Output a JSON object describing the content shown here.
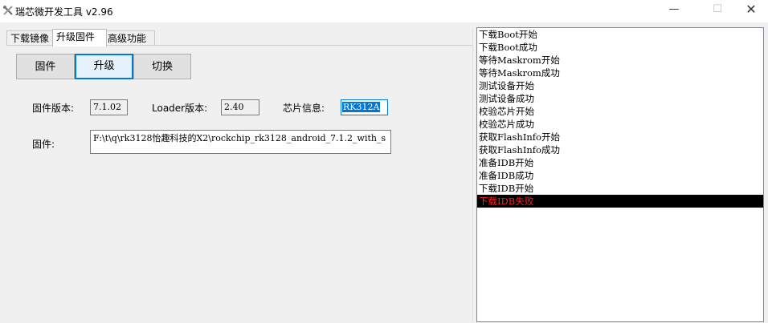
{
  "window": {
    "title": "瑞芯微开发工具 v2.96",
    "min_glyph": "—",
    "max_glyph": "☐",
    "close_glyph": "✕"
  },
  "tabs": [
    {
      "label": "下载镜像",
      "active": false
    },
    {
      "label": "升级固件",
      "active": true
    },
    {
      "label": "高级功能",
      "active": false
    }
  ],
  "buttons": {
    "firmware": "固件",
    "upgrade": "升级",
    "switch": "切换"
  },
  "info": {
    "firmware_version_label": "固件版本:",
    "firmware_version": "7.1.02",
    "loader_version_label": "Loader版本:",
    "loader_version": "2.40",
    "chip_info_label": "芯片信息:",
    "chip_info": "RK312A",
    "firmware_label": "固件:",
    "firmware_path": "F:\\t\\q\\rk3128怡趣科技的X2\\rockchip_rk3128_android_7.1.2_with_s"
  },
  "log": [
    {
      "text": "下载Boot开始",
      "error": false
    },
    {
      "text": "下载Boot成功",
      "error": false
    },
    {
      "text": "等待Maskrom开始",
      "error": false
    },
    {
      "text": "等待Maskrom成功",
      "error": false
    },
    {
      "text": "测试设备开始",
      "error": false
    },
    {
      "text": "测试设备成功",
      "error": false
    },
    {
      "text": "校验芯片开始",
      "error": false
    },
    {
      "text": "校验芯片成功",
      "error": false
    },
    {
      "text": "获取FlashInfo开始",
      "error": false
    },
    {
      "text": "获取FlashInfo成功",
      "error": false
    },
    {
      "text": "准备IDB开始",
      "error": false
    },
    {
      "text": "准备IDB成功",
      "error": false
    },
    {
      "text": "下载IDB开始",
      "error": false
    },
    {
      "text": "下载IDB失败",
      "error": true
    }
  ],
  "colors": {
    "accent": "#0078d7",
    "error_text": "#ff2020",
    "error_bg": "#000000"
  }
}
